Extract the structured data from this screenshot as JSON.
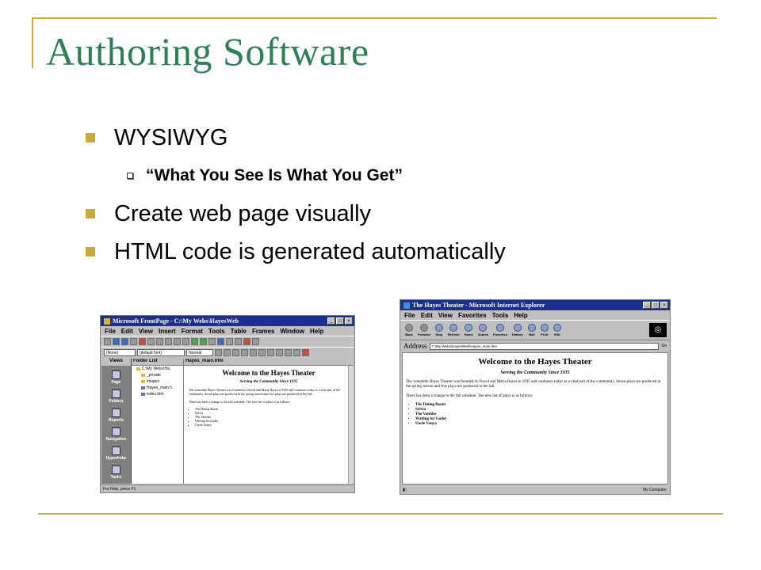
{
  "slide": {
    "title": "Authoring Software",
    "bullets": {
      "b1": "WYSIWYG",
      "b1_sub": "“What You See Is What You Get”",
      "b2": "Create web page visually",
      "b3": "HTML code is generated automatically"
    }
  },
  "frontpage": {
    "title": "Microsoft FrontPage - C:\\My Webs\\HayesWeb",
    "menu": [
      "File",
      "Edit",
      "View",
      "Insert",
      "Format",
      "Tools",
      "Table",
      "Frames",
      "Window",
      "Help"
    ],
    "style_combo": "(None)",
    "font_combo": "(default font)",
    "size_combo": "Normal",
    "views_header": "Views",
    "views": [
      "Page",
      "Folders",
      "Reports",
      "Navigation",
      "Hyperlinks",
      "Tasks"
    ],
    "folder_header": "Folder List",
    "tree": [
      "C:\\My Webs\\Ha",
      "_private",
      "images",
      "Hayes_main.h",
      "index.htm"
    ],
    "editor_header": "Hayes_main.htm",
    "page_title": "Welcome to the Hayes Theater",
    "page_subtitle": "Serving the Community Since 1935",
    "page_para1": "The venerable Hayes Theater was founded by David and Maria Hayes in 1935 and continues today as a vital part of the community. Seven plays are produced in the spring season and five plays are produced in the fall.",
    "page_para2": "There has been a change to the fall schedule. The new list of plays is as follows:",
    "plays": [
      "The Dining Room",
      "Sylvia",
      "The Vanities",
      "Waiting for Godot",
      "Uncle Vanya"
    ],
    "status": "For Help, press F1"
  },
  "ie": {
    "title": "The Hayes Theater - Microsoft Internet Explorer",
    "menu": [
      "File",
      "Edit",
      "View",
      "Favorites",
      "Tools",
      "Help"
    ],
    "toolbar": [
      "Back",
      "Forward",
      "Stop",
      "Refresh",
      "Home",
      "Search",
      "Favorites",
      "History",
      "Mail",
      "Print",
      "Edit"
    ],
    "address_label": "Address",
    "address_value": "C:\\My Webs\\HayesWeb\\Hayes_main.htm",
    "go_label": "Go",
    "page_title": "Welcome to the Hayes Theater",
    "page_subtitle": "Serving the Community Since 1935",
    "page_para1": "The venerable Hayes Theater was founded by David and Maria Hayes in 1935 and continues today as a vital part of the community. Seven plays are produced in the spring season and five plays are produced in the fall.",
    "page_para2": "There has been a change to the fall schedule. The new list of plays is as follows:",
    "plays": [
      "The Dining Room",
      "Sylvia",
      "The Vanities",
      "Waiting for Godot",
      "Uncle Vanya"
    ],
    "status_zone": "My Computer"
  }
}
